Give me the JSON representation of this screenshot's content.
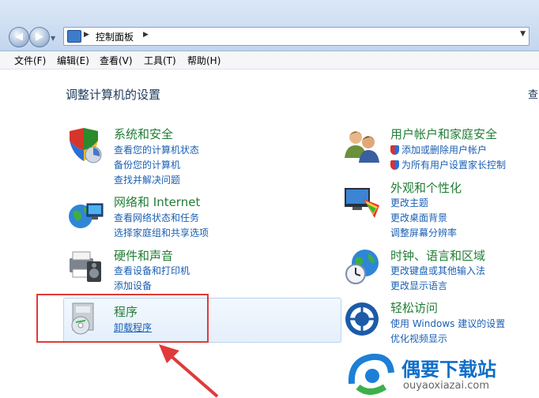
{
  "address_bar": {
    "crumb": "控制面板"
  },
  "menu": [
    "文件(F)",
    "编辑(E)",
    "查看(V)",
    "工具(T)",
    "帮助(H)"
  ],
  "heading": "调整计算机的设置",
  "heading_cut": "查",
  "left_categories": [
    {
      "title": "系统和安全",
      "links": [
        "查看您的计算机状态",
        "备份您的计算机",
        "查找并解决问题"
      ]
    },
    {
      "title": "网络和 Internet",
      "links": [
        "查看网络状态和任务",
        "选择家庭组和共享选项"
      ]
    },
    {
      "title": "硬件和声音",
      "links": [
        "查看设备和打印机",
        "添加设备"
      ]
    },
    {
      "title": "程序",
      "links": [
        "卸载程序"
      ]
    }
  ],
  "right_categories": [
    {
      "title": "用户帐户和家庭安全",
      "links": [
        "添加或删除用户帐户",
        "为所有用户设置家长控制"
      ]
    },
    {
      "title": "外观和个性化",
      "links": [
        "更改主题",
        "更改桌面背景",
        "调整屏幕分辨率"
      ]
    },
    {
      "title": "时钟、语言和区域",
      "links": [
        "更改键盘或其他输入法",
        "更改显示语言"
      ]
    },
    {
      "title": "轻松访问",
      "links": [
        "使用 Windows 建议的设置",
        "优化视频显示"
      ]
    }
  ],
  "watermark": {
    "title": "偶要下载站",
    "url": "ouyaoxiazai.com"
  },
  "colors": {
    "title_green": "#217d36",
    "link_blue": "#1a5fb4",
    "highlight_red": "#e03a3a"
  }
}
